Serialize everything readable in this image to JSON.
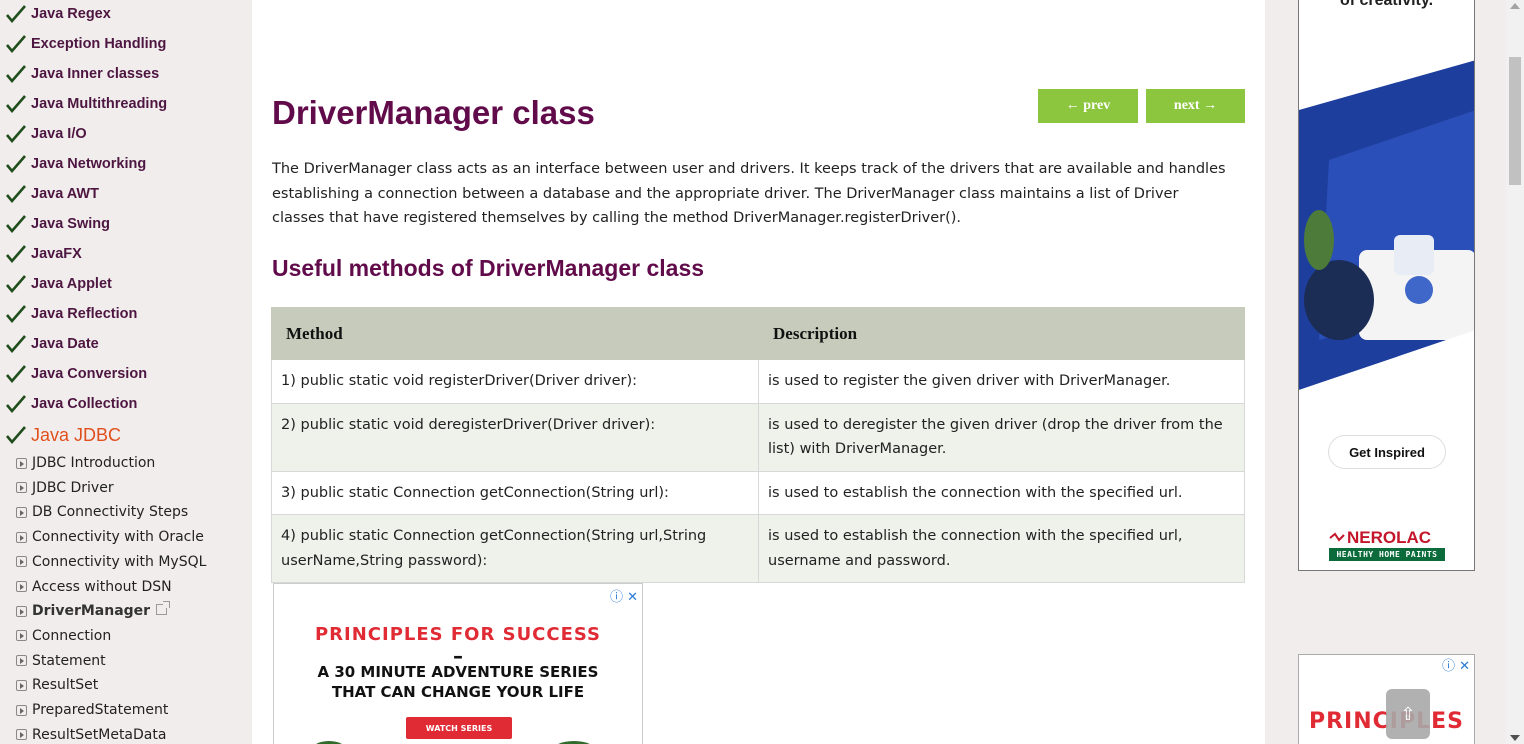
{
  "sidebar": {
    "items": [
      {
        "label": "Java Regex"
      },
      {
        "label": "Exception Handling"
      },
      {
        "label": "Java Inner classes"
      },
      {
        "label": "Java Multithreading"
      },
      {
        "label": "Java I/O"
      },
      {
        "label": "Java Networking"
      },
      {
        "label": "Java AWT"
      },
      {
        "label": "Java Swing"
      },
      {
        "label": "JavaFX"
      },
      {
        "label": "Java Applet"
      },
      {
        "label": "Java Reflection"
      },
      {
        "label": "Java Date"
      },
      {
        "label": "Java Conversion"
      },
      {
        "label": "Java Collection"
      },
      {
        "label": "Java JDBC"
      }
    ],
    "sub_items": [
      {
        "label": "JDBC Introduction"
      },
      {
        "label": "JDBC Driver"
      },
      {
        "label": "DB Connectivity Steps"
      },
      {
        "label": "Connectivity with Oracle"
      },
      {
        "label": "Connectivity with MySQL"
      },
      {
        "label": "Access without DSN"
      },
      {
        "label": "DriverManager"
      },
      {
        "label": "Connection"
      },
      {
        "label": "Statement"
      },
      {
        "label": "ResultSet"
      },
      {
        "label": "PreparedStatement"
      },
      {
        "label": "ResultSetMetaData"
      }
    ]
  },
  "main": {
    "title": "DriverManager class",
    "prev_label": "← prev",
    "next_label": "next →",
    "intro": "The DriverManager class acts as an interface between user and drivers. It keeps track of the drivers that are available and handles establishing a connection between a database and the appropriate driver. The DriverManager class maintains a list of Driver classes that have registered themselves by calling the method DriverManager.registerDriver().",
    "subheading": "Useful methods of DriverManager class",
    "table": {
      "headers": [
        "Method",
        "Description"
      ],
      "rows": [
        {
          "method": "1) public static void registerDriver(Driver driver):",
          "description": "is used to register the given driver with DriverManager."
        },
        {
          "method": "2) public static void deregisterDriver(Driver driver):",
          "description": "is used to deregister the given driver (drop the driver from the list) with DriverManager."
        },
        {
          "method": "3) public static Connection getConnection(String url):",
          "description": "is used to establish the connection with the specified url."
        },
        {
          "method": "4) public static Connection getConnection(String url,String userName,String password):",
          "description": "is used to establish the connection with the specified url, username and password."
        }
      ]
    }
  },
  "ad_inline": {
    "title": "PRINCIPLES FOR SUCCESS",
    "dash": "–",
    "line1": "A 30 MINUTE ADVENTURE SERIES",
    "line2": "THAT CAN CHANGE YOUR LIFE",
    "cta": "WATCH SERIES",
    "controls": "ⓘ ✕"
  },
  "ad_right": {
    "top_text": "of creativity.",
    "cta": "Get Inspired",
    "brand": "NEROLAC",
    "brand_tag": "HEALTHY HOME PAINTS"
  },
  "ad_right2": {
    "title": "PRINCIPLES",
    "controls": "ⓘ ✕"
  },
  "scroll_top_label": "⇧",
  "colors": {
    "sidebar_bg": "#f2eded",
    "link": "#4d1641",
    "active": "#e0501d",
    "title": "#610b4b",
    "button": "#8cc63e",
    "table_header": "#c7cbbc",
    "row_alt": "#eef2ea"
  }
}
